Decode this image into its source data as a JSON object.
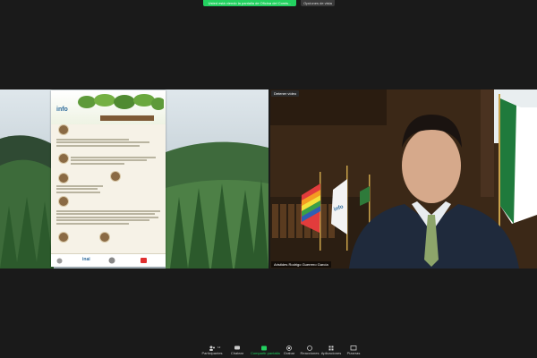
{
  "banner": {
    "share_text": "Usted está viendo la pantalla de Oficina del Comis...",
    "view_options": "Opciones de vista"
  },
  "infographic": {
    "logo": "info"
  },
  "video": {
    "stop_video": "Detener vídeo",
    "participant_name": "Aristides Rodrigo Guerrero García",
    "flag_text": "info"
  },
  "toolbar": {
    "items": [
      {
        "label": "Participantes",
        "icon": "participants-icon",
        "count": "12"
      },
      {
        "label": "Chatear",
        "icon": "chat-icon"
      },
      {
        "label": "Compartir pantalla",
        "icon": "share-screen-icon"
      },
      {
        "label": "Grabar",
        "icon": "record-icon"
      },
      {
        "label": "Reacciones",
        "icon": "reactions-icon"
      },
      {
        "label": "Aplicaciones",
        "icon": "apps-icon"
      },
      {
        "label": "Pizarras",
        "icon": "whiteboard-icon"
      }
    ]
  },
  "colors": {
    "accent_green": "#23d160",
    "background": "#1a1a1a"
  }
}
